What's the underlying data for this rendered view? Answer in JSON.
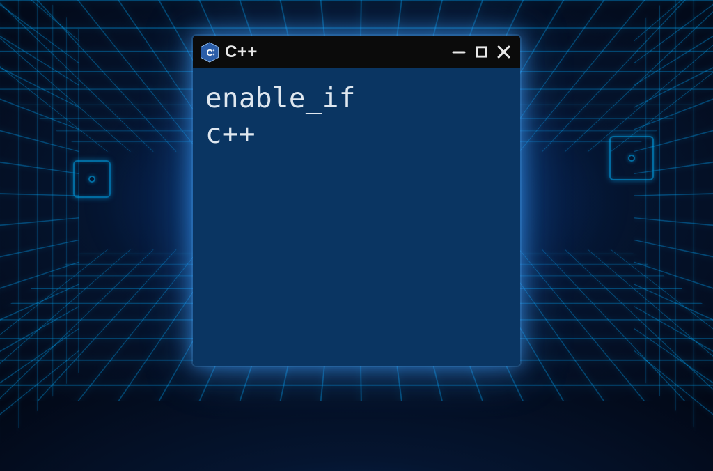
{
  "window": {
    "title": "C++",
    "icon_name": "cpp-logo"
  },
  "content": {
    "lines": [
      "enable_if",
      "c++"
    ]
  },
  "colors": {
    "content_bg": "#0a3562",
    "titlebar_bg": "#0b0b0b",
    "glow": "#2a9bff"
  }
}
